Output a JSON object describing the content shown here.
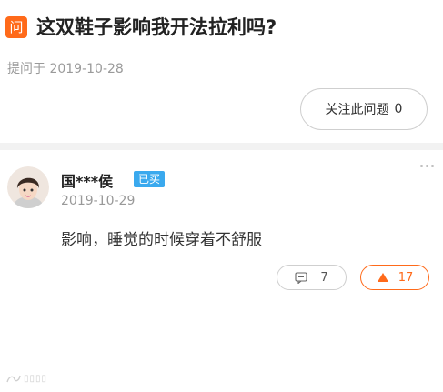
{
  "question": {
    "badge_char": "问",
    "title": "这双鞋子影响我开法拉利吗?",
    "meta": "提问于 2019-10-28",
    "follow_label": "关注此问题",
    "follow_count": "0"
  },
  "answer": {
    "author": "国***侯",
    "badge": "已买",
    "date": "2019-10-29",
    "text": "影响，睡觉的时候穿着不舒服",
    "comment_count": "7",
    "like_count": "17"
  },
  "colors": {
    "accent": "#ff6a1a",
    "buyer_badge": "#3aa9ee",
    "divider": "#f2f2f2"
  },
  "icons": [
    "question-badge-icon",
    "more-dots-icon",
    "comment-icon",
    "thumbs-up-triangle-icon"
  ]
}
